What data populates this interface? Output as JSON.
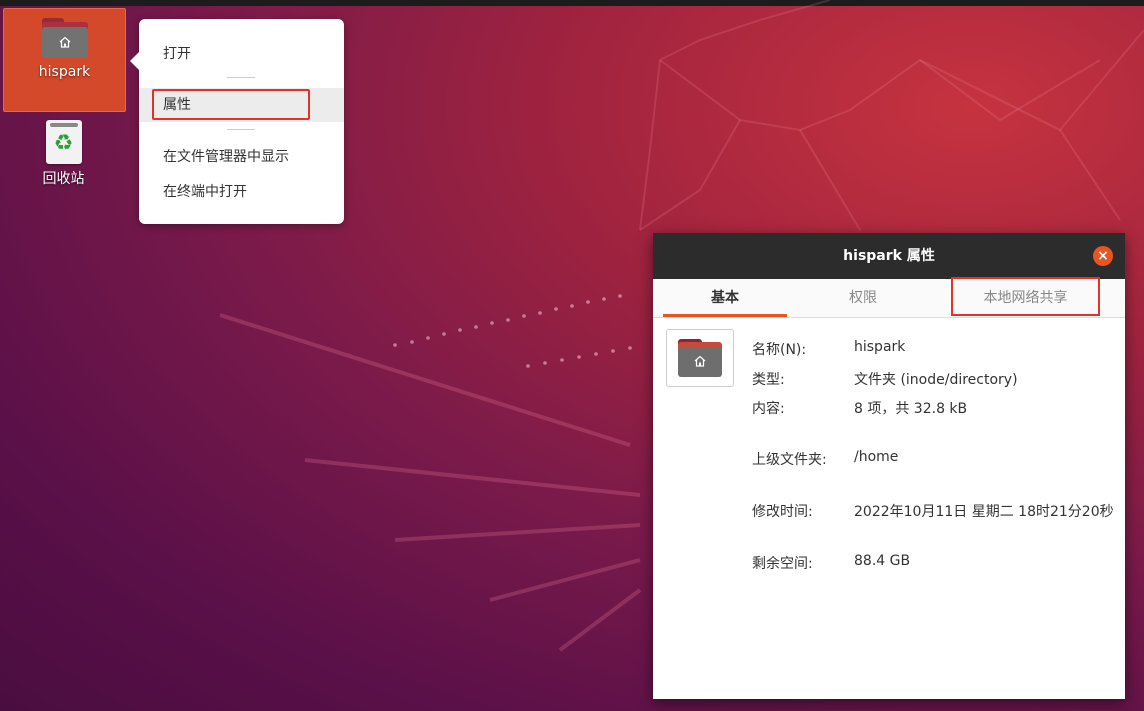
{
  "desktop": {
    "icons": [
      {
        "label": "hispark"
      },
      {
        "label": "回收站"
      }
    ]
  },
  "context_menu": {
    "items": [
      {
        "label": "打开"
      },
      {
        "label": "属性"
      },
      {
        "label": "在文件管理器中显示"
      },
      {
        "label": "在终端中打开"
      }
    ]
  },
  "properties_window": {
    "title": "hispark 属性",
    "close_symbol": "×",
    "tabs": [
      {
        "label": "基本"
      },
      {
        "label": "权限"
      },
      {
        "label": "本地网络共享"
      }
    ],
    "fields": [
      {
        "label": "名称(N):",
        "value": "hispark"
      },
      {
        "label": "类型:",
        "value": "文件夹 (inode/directory)"
      },
      {
        "label": "内容:",
        "value": "8 项，共 32.8 kB"
      },
      {
        "label": "上级文件夹:",
        "value": "/home"
      },
      {
        "label": "修改时间:",
        "value": "2022年10月11日 星期二 18时21分20秒"
      },
      {
        "label": "剩余空间:",
        "value": "88.4 GB"
      }
    ]
  },
  "colors": {
    "accent": "#e95420",
    "highlight_box": "#e8302a",
    "selection": "#d4492a"
  }
}
